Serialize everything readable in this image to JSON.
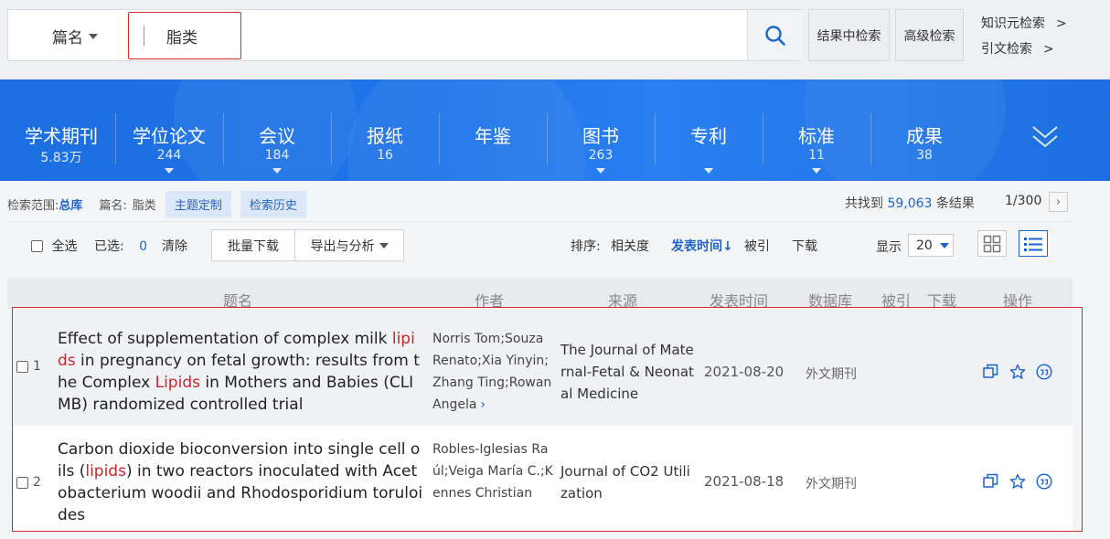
{
  "search": {
    "field": "篇名",
    "query": "脂类",
    "in_results_label": "结果中检索",
    "advanced_label": "高级检索",
    "side_links": [
      "知识元检索",
      "引文检索"
    ]
  },
  "categories": [
    {
      "name": "学术期刊",
      "count": "5.83万",
      "has_menu": false
    },
    {
      "name": "学位论文",
      "count": "244",
      "has_menu": true
    },
    {
      "name": "会议",
      "count": "184",
      "has_menu": true
    },
    {
      "name": "报纸",
      "count": "16",
      "has_menu": false
    },
    {
      "name": "年鉴",
      "count": "",
      "has_menu": false
    },
    {
      "name": "图书",
      "count": "263",
      "has_menu": true
    },
    {
      "name": "专利",
      "count": "",
      "has_menu": true
    },
    {
      "name": "标准",
      "count": "11",
      "has_menu": true
    },
    {
      "name": "成果",
      "count": "38",
      "has_menu": false
    }
  ],
  "scope": {
    "label": "检索范围:",
    "value": "总库",
    "field_label": "篇名:",
    "field_value": "脂类",
    "topic_btn": "主题定制",
    "history_btn": "检索历史"
  },
  "summary": {
    "prefix": "共找到",
    "count": "59,063",
    "suffix": "条结果",
    "page": "1/300"
  },
  "toolbar": {
    "select_all": "全选",
    "selected_label": "已选:",
    "selected_count": "0",
    "clear": "清除",
    "batch_download": "批量下载",
    "export": "导出与分析",
    "sort_label": "排序:",
    "sort_relevance": "相关度",
    "sort_date": "发表时间",
    "sort_cited": "被引",
    "sort_download": "下载",
    "display_label": "显示",
    "display_value": "20"
  },
  "columns": [
    "题名",
    "作者",
    "来源",
    "发表时间",
    "数据库",
    "被引",
    "下载",
    "操作"
  ],
  "results": [
    {
      "index": "1",
      "title_parts": [
        {
          "text": "Effect of supplementation of complex milk ",
          "hl": false
        },
        {
          "text": "lipids",
          "hl": true
        },
        {
          "text": " in pregnancy on fetal growth: results from the Complex ",
          "hl": false
        },
        {
          "text": "Lipids",
          "hl": true
        },
        {
          "text": " in Mothers and Babies (CLIMB) randomized controlled trial",
          "hl": false
        }
      ],
      "authors": "Norris Tom;Souza Renato;Xia Yinyin;Zhang Ting;Rowan Angela",
      "source": "The Journal of Maternal-Fetal & Neonatal Medicine",
      "date": "2021-08-20",
      "database": "外文期刊"
    },
    {
      "index": "2",
      "title_parts": [
        {
          "text": "Carbon dioxide bioconversion into single cell oils (",
          "hl": false
        },
        {
          "text": "lipids",
          "hl": true
        },
        {
          "text": ") in two reactors inoculated with Acetobacterium woodii and Rhodosporidium toruloides",
          "hl": false
        }
      ],
      "authors": "Robles-Iglesias Raúl;Veiga María C.;Kennes Christian",
      "source": "Journal of CO2 Utilization",
      "date": "2021-08-18",
      "database": "外文期刊"
    }
  ]
}
